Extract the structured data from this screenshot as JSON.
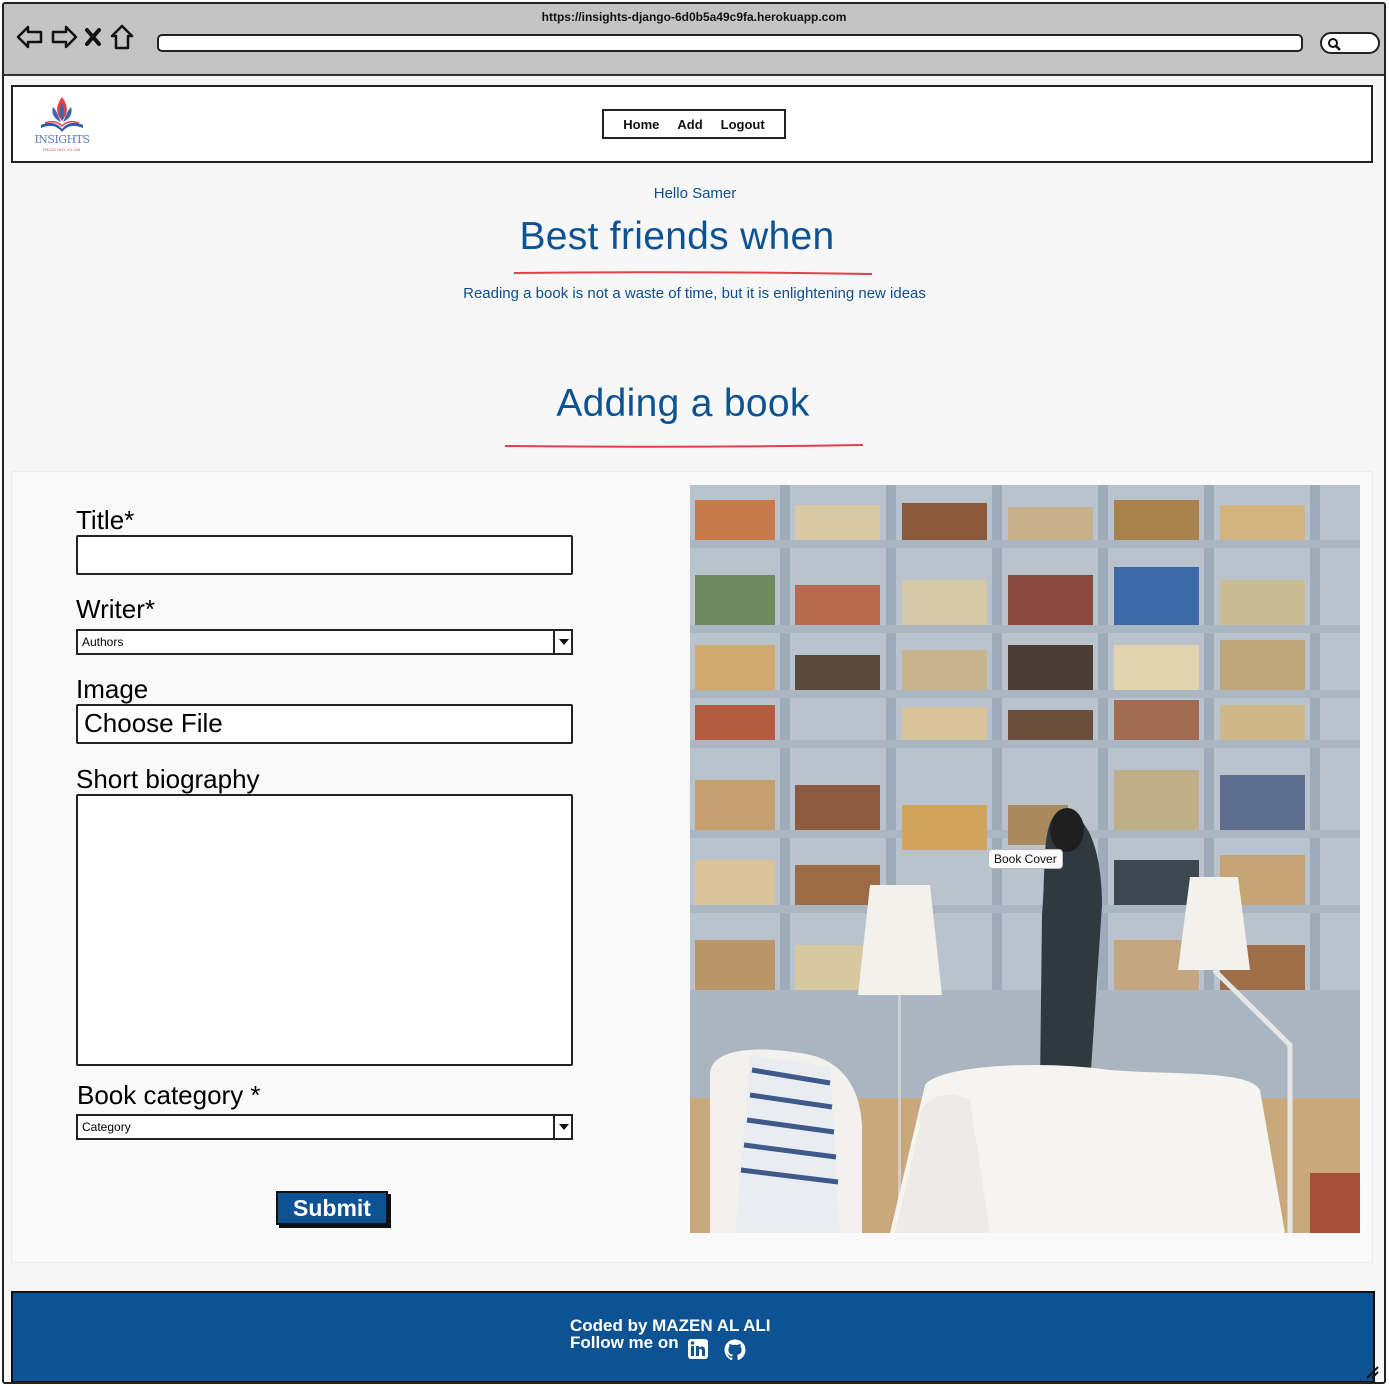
{
  "browser": {
    "url": "https://insights-django-6d0b5a49c9fa.herokuapp.com"
  },
  "header": {
    "logo_text": "INSIGHTS",
    "logo_subtext": "READING CLUB",
    "nav": [
      "Home",
      "Add",
      "Logout"
    ]
  },
  "hero": {
    "greeting": "Hello Samer",
    "title": "Best friends when",
    "tagline": "Reading a book is not a waste of time, but it is enlightening new ideas"
  },
  "form": {
    "heading": "Adding a book",
    "title_label": "Title*",
    "title_value": "",
    "writer_label": "Writer*",
    "writer_selected": "Authors",
    "image_label": "Image",
    "image_button": "Choose File",
    "bio_label": "Short biography",
    "bio_value": "",
    "category_label": "Book category *",
    "category_selected": "Category",
    "submit_label": "Submit"
  },
  "image": {
    "tooltip": "Book Cover"
  },
  "footer": {
    "coded_by": "Coded by MAZEN AL ALI",
    "follow": "Follow me on",
    "icons": [
      "linkedin-icon",
      "github-icon"
    ]
  },
  "colors": {
    "brand_blue": "#0d5394",
    "accent_red": "#e0414a",
    "chrome_gray": "#c4c4c4"
  }
}
